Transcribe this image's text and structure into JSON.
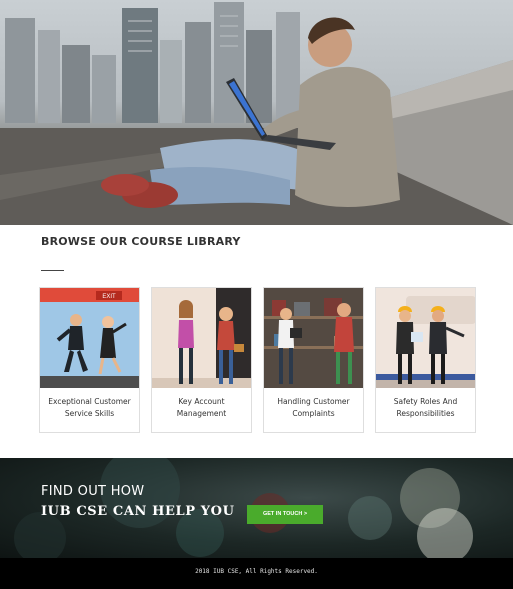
{
  "section": {
    "title": "BROWSE OUR COURSE LIBRARY"
  },
  "courses": [
    {
      "title": "Exceptional Customer Service Skills",
      "sign": "EXIT"
    },
    {
      "title": "Key Account Management"
    },
    {
      "title": "Handling Customer Complaints"
    },
    {
      "title": "Safety Roles And Responsibilities"
    }
  ],
  "cta": {
    "line1": "FIND OUT HOW",
    "line2": "IUB CSE CAN HELP YOU",
    "button_label": "GET IN TOUCH >"
  },
  "footer": {
    "copyright": "2018 IUB CSE, All Rights Reserved."
  },
  "colors": {
    "accent_green": "#4aab2c",
    "footer_bg": "#000000"
  }
}
